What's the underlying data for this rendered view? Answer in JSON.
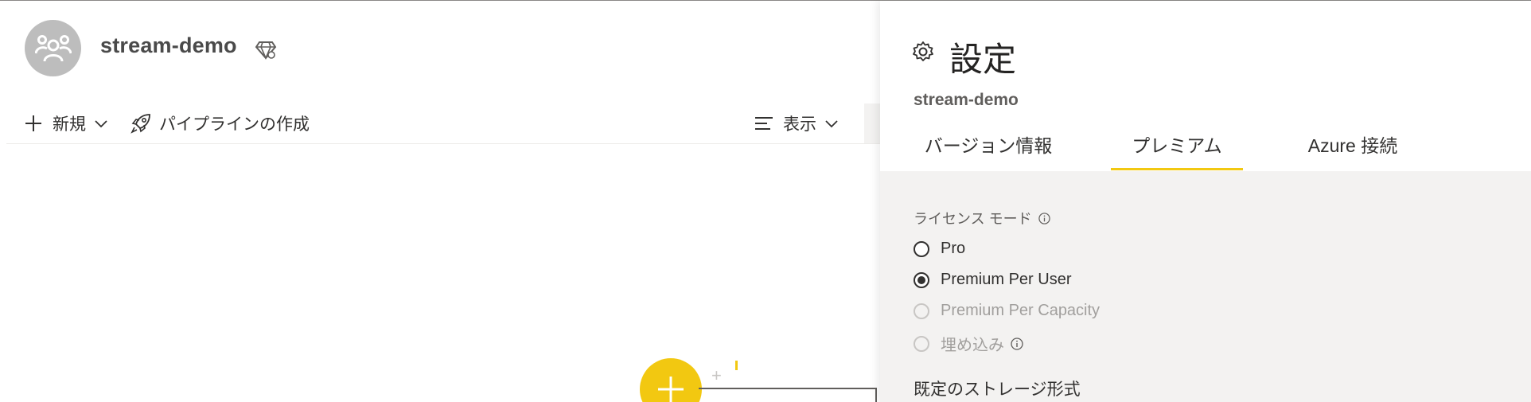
{
  "workspace": {
    "name": "stream-demo",
    "icons": {
      "avatar": "people-group-icon",
      "premium": "diamond-icon"
    }
  },
  "command_bar": {
    "new_label": "新規",
    "pipeline_label": "パイプラインの作成",
    "view_label": "表示",
    "icons": {
      "new": "plus-icon",
      "pipeline": "rocket-icon",
      "view": "view-lines-icon",
      "chevron": "chevron-down-icon"
    }
  },
  "canvas": {
    "icons": {
      "add": "plus-icon"
    }
  },
  "settings_panel": {
    "title": "設定",
    "subtitle": "stream-demo",
    "tabs": [
      {
        "label": "バージョン情報",
        "selected": false
      },
      {
        "label": "プレミアム",
        "selected": true
      },
      {
        "label": "Azure 接続",
        "selected": false
      }
    ],
    "license_mode": {
      "label": "ライセンス モード",
      "options": [
        {
          "label": "Pro",
          "selected": false,
          "enabled": true
        },
        {
          "label": "Premium Per User",
          "selected": true,
          "enabled": true
        },
        {
          "label": "Premium Per Capacity",
          "selected": false,
          "enabled": false
        },
        {
          "label": "埋め込み",
          "selected": false,
          "enabled": false
        }
      ]
    },
    "storage_format_label": "既定のストレージ形式"
  },
  "colors": {
    "accent": "#f2c811",
    "panel_bg": "#f3f2f1",
    "text": "#323130",
    "disabled_text": "#a19f9d"
  }
}
